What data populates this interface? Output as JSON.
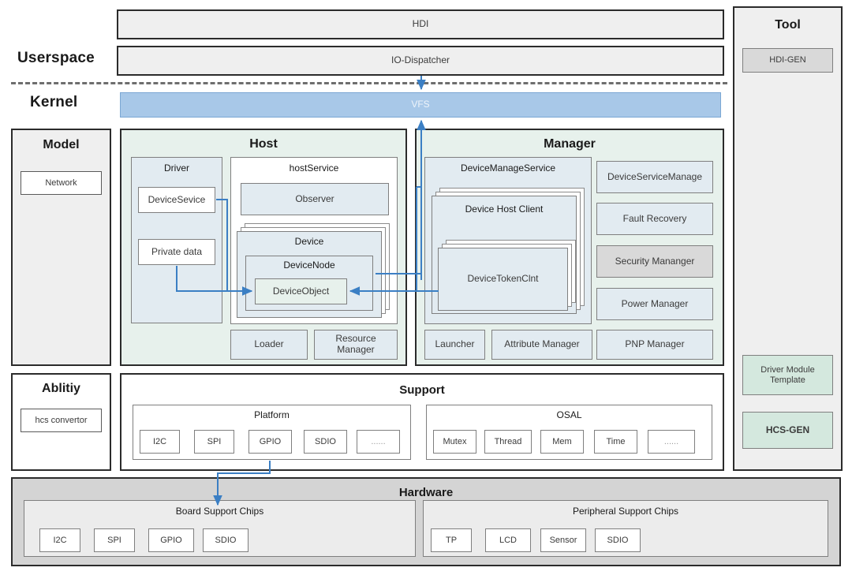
{
  "labels": {
    "userspace": "Userspace",
    "kernel": "Kernel"
  },
  "userspace": {
    "hdi": "HDI",
    "io_dispatcher": "IO-Dispatcher"
  },
  "kernel": {
    "vfs": "VFS"
  },
  "model": {
    "title": "Model",
    "items": [
      "Network"
    ]
  },
  "ability": {
    "title": "Ablitiy",
    "items": [
      "hcs convertor"
    ]
  },
  "host": {
    "title": "Host",
    "driver": {
      "title": "Driver",
      "items": [
        "DeviceSevice",
        "Private data"
      ]
    },
    "hostService": {
      "title": "hostService",
      "observer": "Observer",
      "device": {
        "title": "Device",
        "deviceNode": "DeviceNode",
        "deviceObject": "DeviceObject"
      }
    },
    "footer": [
      "Loader",
      "Resource\nManager"
    ]
  },
  "manager": {
    "title": "Manager",
    "deviceManageService": {
      "title": "DeviceManageService",
      "deviceHostClient": "Device Host Client",
      "deviceTokenClnt": "DeviceTokenClnt"
    },
    "right_items": [
      "DeviceServiceManage",
      "Fault Recovery",
      "Security Mananger",
      "Power Manager"
    ],
    "footer": [
      "Launcher",
      "Attribute Manager",
      "PNP Manager"
    ]
  },
  "support": {
    "title": "Support",
    "platform": {
      "title": "Platform",
      "items": [
        "I2C",
        "SPI",
        "GPIO",
        "SDIO",
        "......"
      ]
    },
    "osal": {
      "title": "OSAL",
      "items": [
        "Mutex",
        "Thread",
        "Mem",
        "Time",
        "......"
      ]
    }
  },
  "hardware": {
    "title": "Hardware",
    "board": {
      "title": "Board Support Chips",
      "items": [
        "I2C",
        "SPI",
        "GPIO",
        "SDIO"
      ]
    },
    "peripheral": {
      "title": "Peripheral Support Chips",
      "items": [
        "TP",
        "LCD",
        "Sensor",
        "SDIO"
      ]
    }
  },
  "tool": {
    "title": "Tool",
    "hdi_gen": "HDI-GEN",
    "driver_module_template": "Driver Module Template",
    "hcs_gen": "HCS-GEN"
  },
  "colors": {
    "arrow": "#3b7fc4",
    "vfs": "#a8c8e8",
    "mint": "#e7f1ec",
    "bluegrey": "#e2ebf1",
    "grey": "#efefef",
    "highlight": "#d9d9d9",
    "hardware": "#d4d4d4"
  }
}
